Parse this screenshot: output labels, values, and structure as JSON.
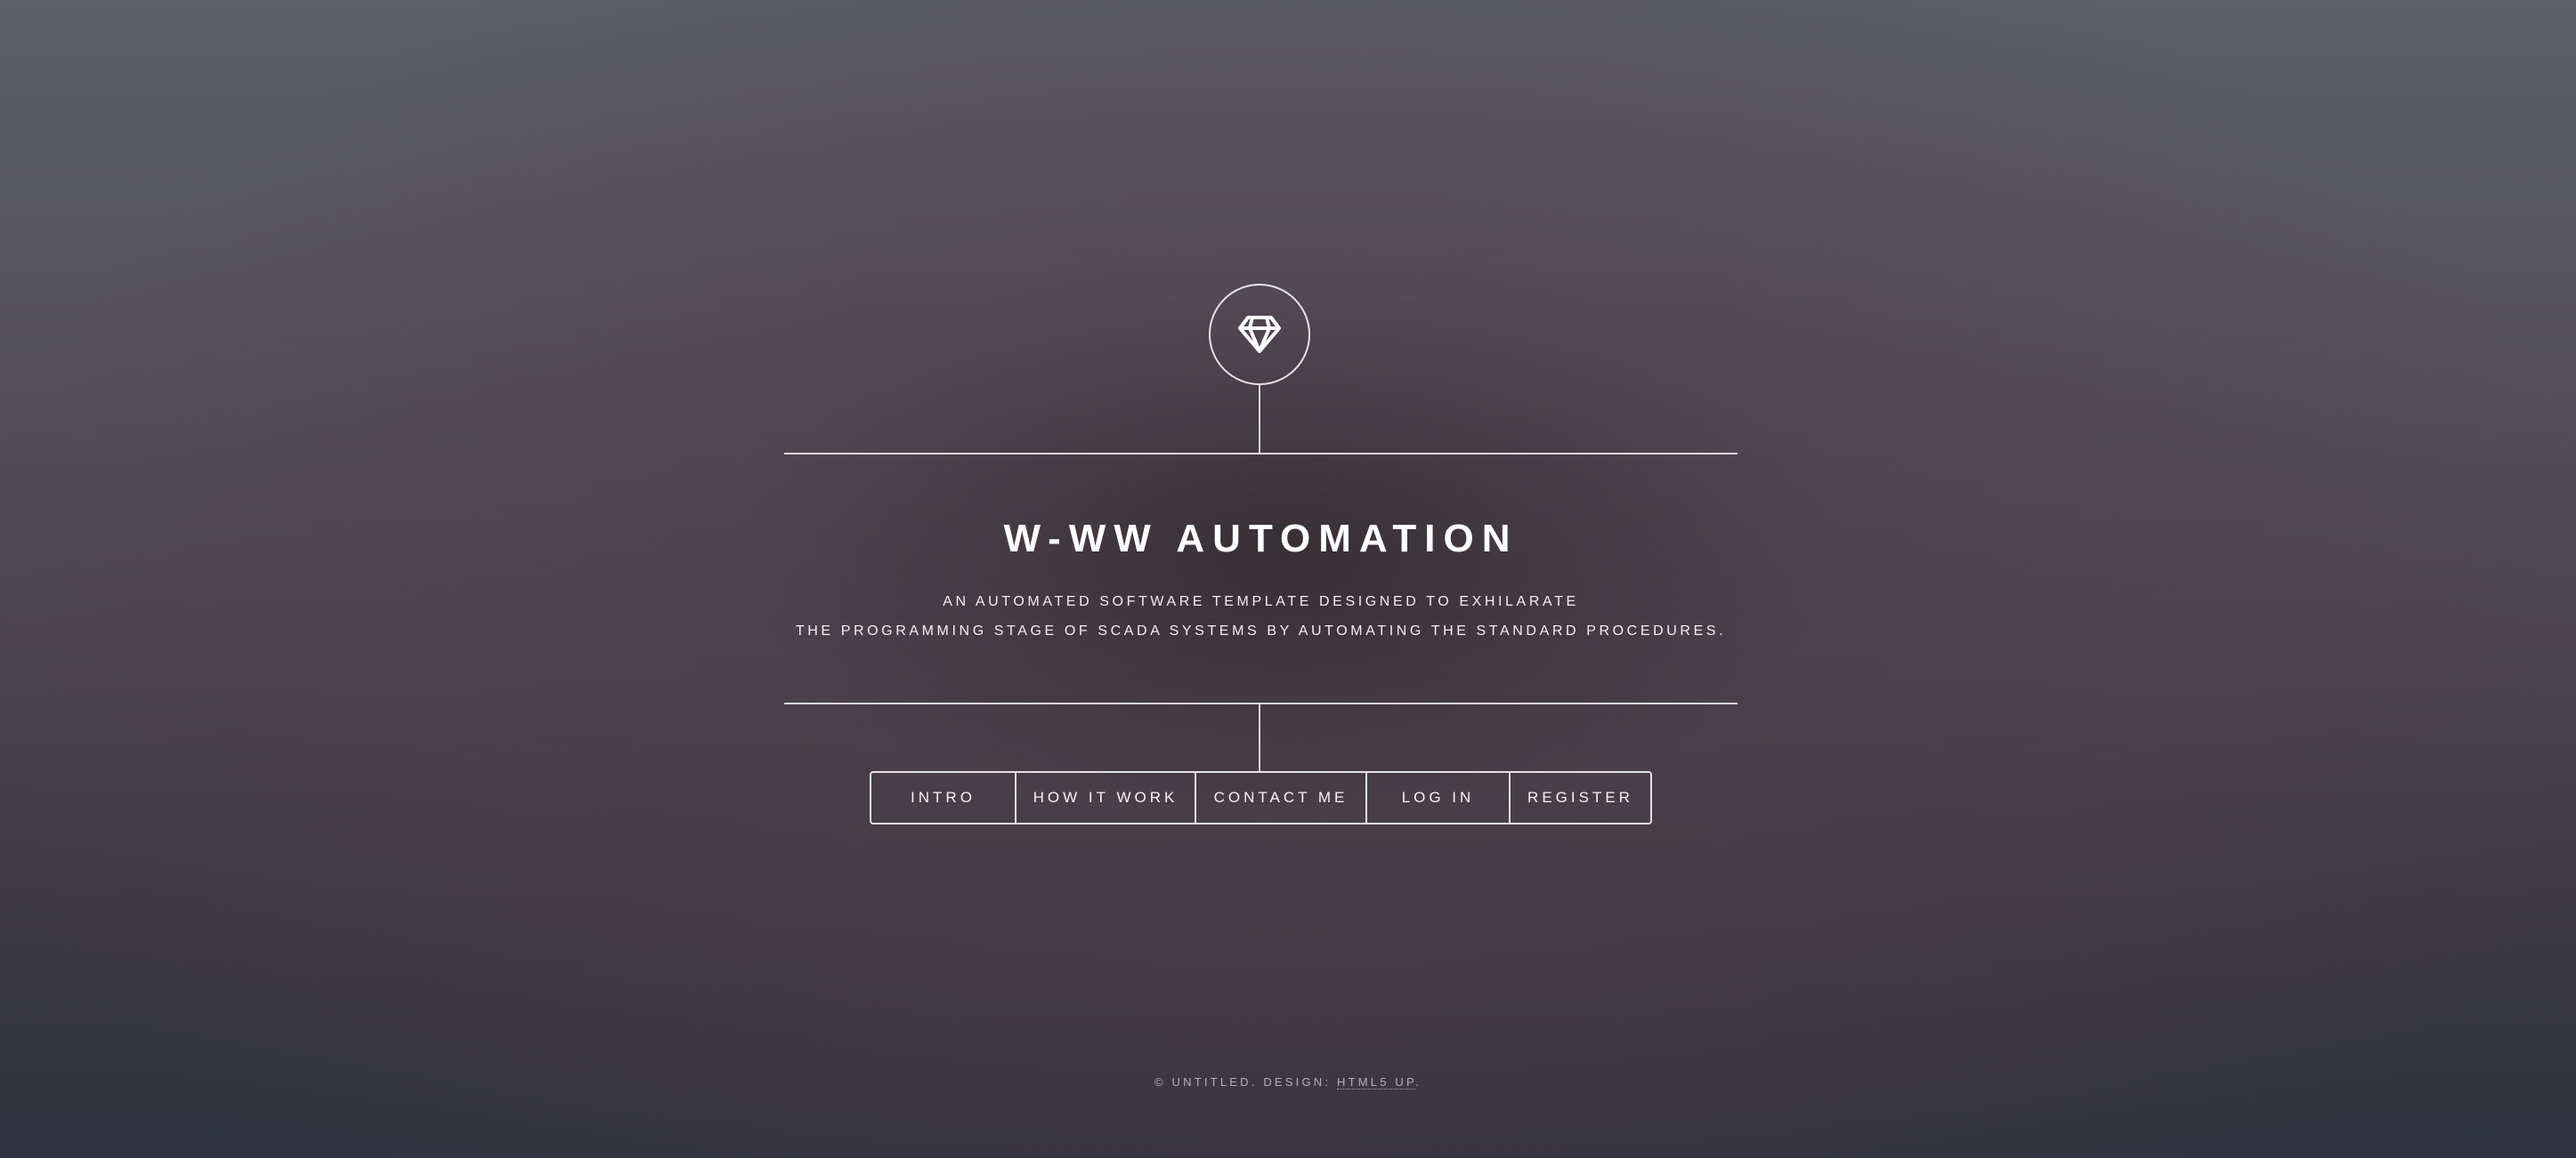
{
  "logo": {
    "icon": "diamond-icon"
  },
  "header": {
    "title": "W-WW AUTOMATION",
    "tagline_line1": "AN AUTOMATED SOFTWARE TEMPLATE DESIGNED TO EXHILARATE",
    "tagline_line2": "THE PROGRAMMING STAGE OF SCADA SYSTEMS BY AUTOMATING THE STANDARD PROCEDURES."
  },
  "nav": {
    "items": [
      {
        "label": "INTRO"
      },
      {
        "label": "HOW IT WORK"
      },
      {
        "label": "CONTACT ME"
      },
      {
        "label": "LOG IN"
      },
      {
        "label": "REGISTER"
      }
    ]
  },
  "footer": {
    "prefix": "© UNTITLED. DESIGN: ",
    "link_label": "HTML5 UP",
    "suffix": "."
  },
  "colors": {
    "text": "#ffffff",
    "background_top": "#5d5f6b",
    "background_bottom": "#2f323f"
  }
}
